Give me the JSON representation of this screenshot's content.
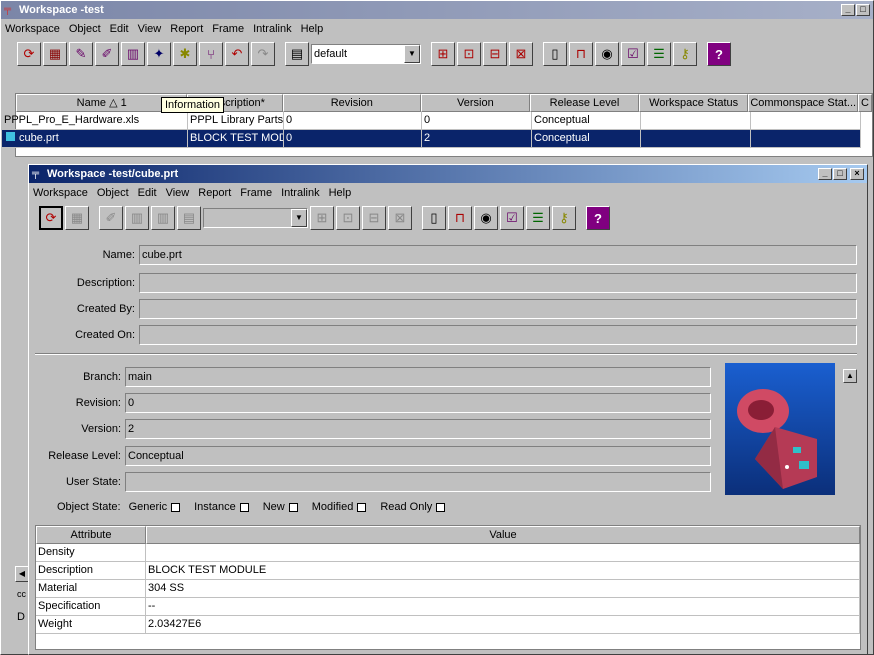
{
  "outer": {
    "title": "Workspace -test",
    "menu": [
      "Workspace",
      "Object",
      "Edit",
      "View",
      "Report",
      "Frame",
      "Intralink",
      "Help"
    ],
    "combo_value": "default",
    "tooltip": "Information",
    "columns": [
      "Name",
      "1",
      "Description*",
      "Revision",
      "Version",
      "Release Level",
      "Workspace Status",
      "Commonspace Stat...",
      "C"
    ],
    "rows": [
      {
        "name": "PPPL_Pro_E_Hardware.xls",
        "description": "PPPL Library Parts",
        "revision": "0",
        "version": "0",
        "release": "Conceptual",
        "ws_status": "",
        "cs_status": ""
      },
      {
        "name": "cube.prt",
        "description": "BLOCK TEST MOD...",
        "revision": "0",
        "version": "2",
        "release": "Conceptual",
        "ws_status": "",
        "cs_status": ""
      }
    ],
    "side_labels": [
      "cc",
      "D"
    ]
  },
  "inner": {
    "title": "Workspace -test/cube.prt",
    "menu": [
      "Workspace",
      "Object",
      "Edit",
      "View",
      "Report",
      "Frame",
      "Intralink",
      "Help"
    ],
    "fields": {
      "name": {
        "label": "Name:",
        "value": "cube.prt"
      },
      "description": {
        "label": "Description:",
        "value": ""
      },
      "created_by": {
        "label": "Created By:",
        "value": ""
      },
      "created_on": {
        "label": "Created On:",
        "value": ""
      },
      "branch": {
        "label": "Branch:",
        "value": "main"
      },
      "revision": {
        "label": "Revision:",
        "value": "0"
      },
      "version": {
        "label": "Version:",
        "value": "2"
      },
      "release_level": {
        "label": "Release Level:",
        "value": "Conceptual"
      },
      "user_state": {
        "label": "User State:",
        "value": ""
      }
    },
    "object_state": {
      "label": "Object State:",
      "items": [
        "Generic",
        "Instance",
        "New",
        "Modified",
        "Read Only"
      ]
    },
    "attr_table": {
      "headers": [
        "Attribute",
        "Value"
      ],
      "rows": [
        {
          "attr": "Density",
          "value": ""
        },
        {
          "attr": "Description",
          "value": "BLOCK TEST MODULE"
        },
        {
          "attr": "Material",
          "value": "304 SS"
        },
        {
          "attr": "Specification",
          "value": "--"
        },
        {
          "attr": "Weight",
          "value": "2.03427E6"
        }
      ]
    }
  },
  "colors": {
    "title_active": "#0a246a",
    "selection": "#0a246a",
    "preview_bg": "#0b3a86",
    "part": "#c8405a"
  }
}
